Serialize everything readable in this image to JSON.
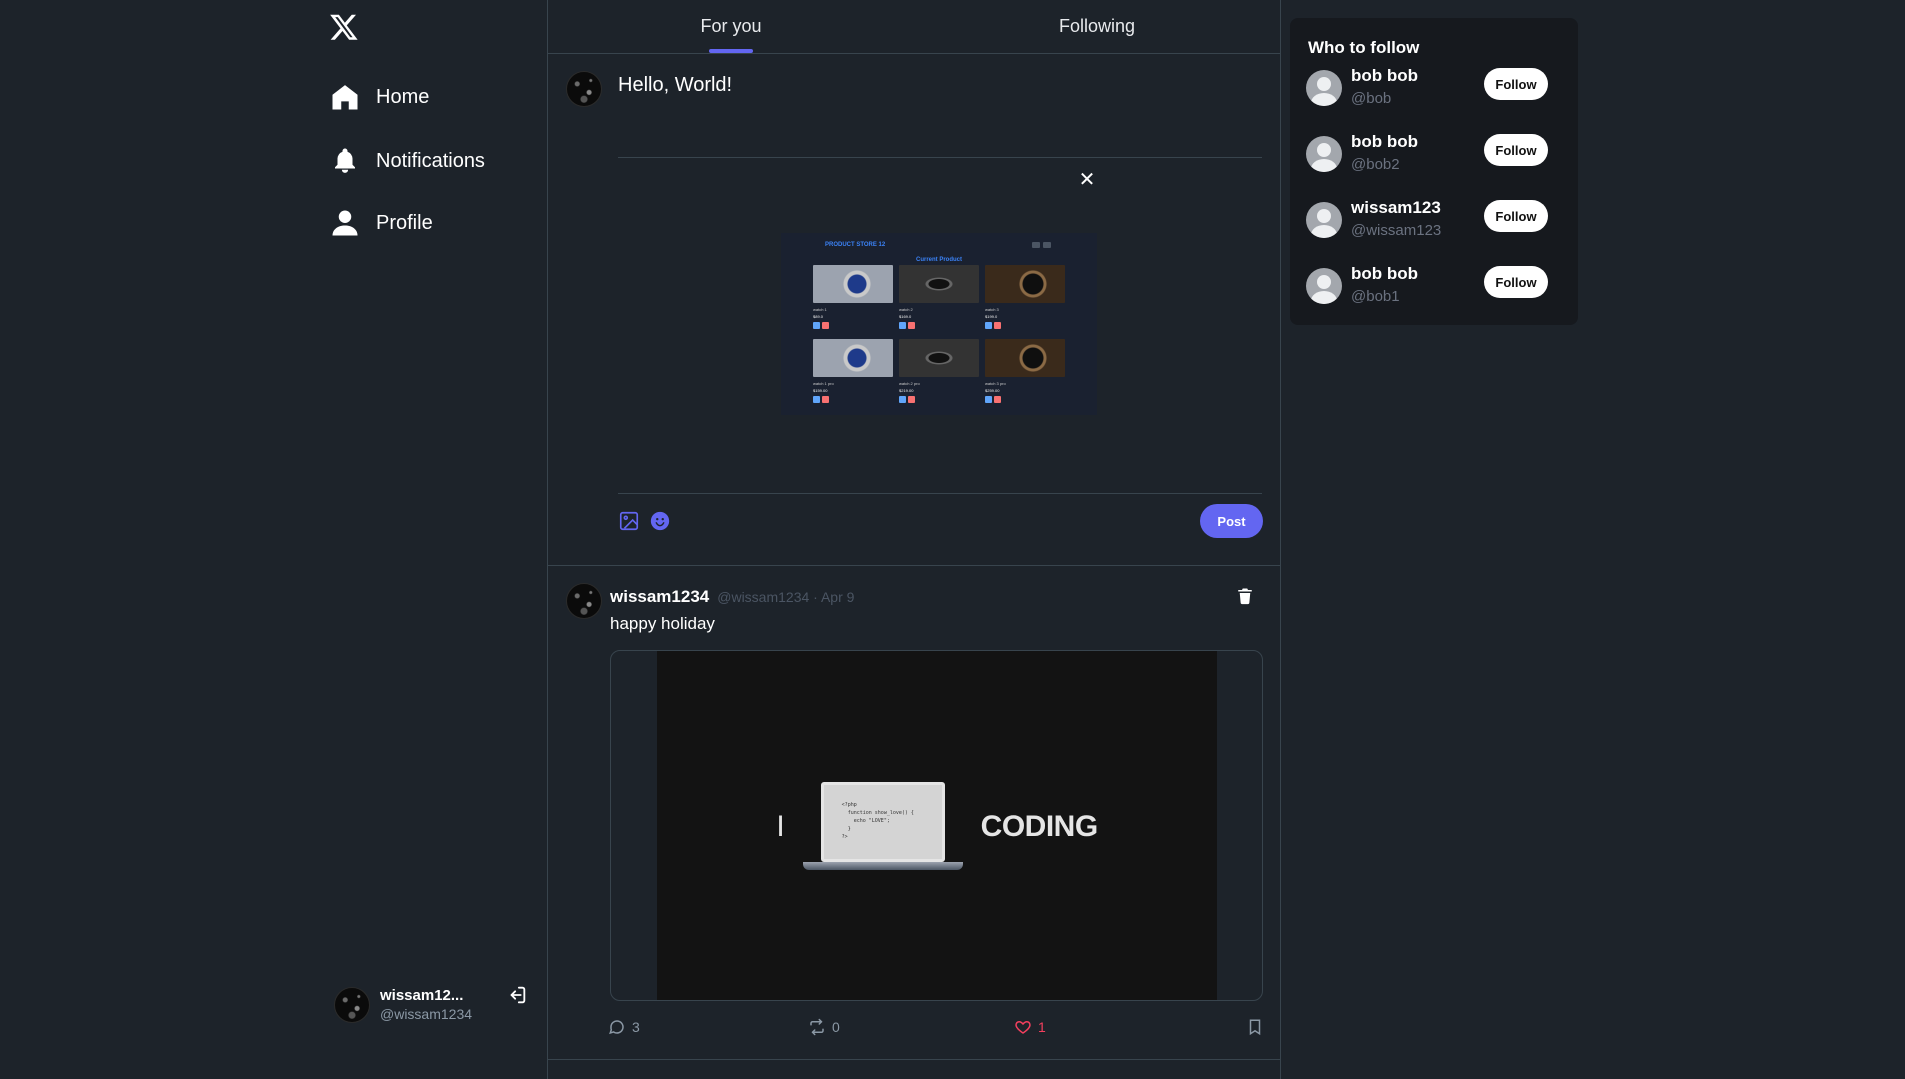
{
  "nav": {
    "logo": "X",
    "items": [
      {
        "label": "Home",
        "icon": "home-icon"
      },
      {
        "label": "Notifications",
        "icon": "bell-icon"
      },
      {
        "label": "Profile",
        "icon": "user-icon"
      }
    ]
  },
  "account": {
    "name": "wissam12...",
    "handle": "@wissam1234"
  },
  "tabs": [
    {
      "label": "For you",
      "active": true
    },
    {
      "label": "Following",
      "active": false
    }
  ],
  "composer": {
    "text": "Hello, World!",
    "close": "✕",
    "post_label": "Post",
    "preview": {
      "title": "PRODUCT STORE 12",
      "subtitle": "Current Product",
      "products": [
        {
          "name": "watch 1",
          "price": "$89.0"
        },
        {
          "name": "watch 2",
          "price": "$169.0"
        },
        {
          "name": "watch 3",
          "price": "$199.0"
        },
        {
          "name": "watch 1 pro",
          "price": "$159.00"
        },
        {
          "name": "watch 2 pro",
          "price": "$219.00"
        },
        {
          "name": "watch 3 pro",
          "price": "$259.00"
        }
      ]
    }
  },
  "post": {
    "author": "wissam1234",
    "meta": "@wissam1234 · Apr 9",
    "text": "happy holiday",
    "media": {
      "left_word": "I",
      "right_word": "CODING",
      "code": "<?php\n  function show_love() {\n    echo \"LOVE\";\n  }\n?>"
    },
    "replies": "3",
    "retweets": "0",
    "likes": "1"
  },
  "who_to_follow": {
    "title": "Who to follow",
    "follow_label": "Follow",
    "users": [
      {
        "name": "bob bob",
        "handle": "@bob"
      },
      {
        "name": "bob bob",
        "handle": "@bob2"
      },
      {
        "name": "wissam123",
        "handle": "@wissam123"
      },
      {
        "name": "bob bob",
        "handle": "@bob1"
      }
    ]
  },
  "colors": {
    "background": "#1d232a",
    "accent": "#6366f1",
    "like": "#f43f5e",
    "panel": "#16191e"
  }
}
